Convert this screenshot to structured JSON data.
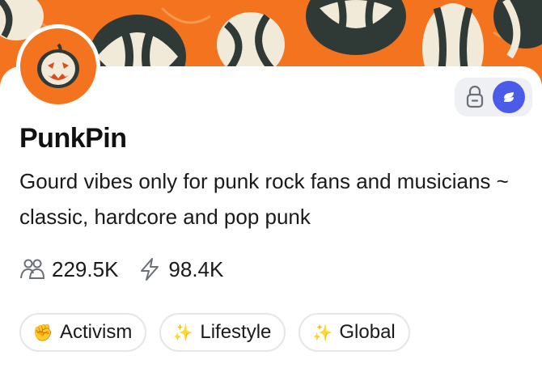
{
  "banner": {
    "background": "#f4731f",
    "pattern_icon": "gourd-pattern-icon"
  },
  "profile": {
    "avatar_icon": "pumpkin-avatar-icon",
    "name": "PunkPin",
    "description": "Gourd vibes only for punk rock fans and musicians ~ classic, hardcore and pop punk"
  },
  "badges": {
    "lock_icon": "lock-icon",
    "verified_icon": "verified-badge-icon",
    "accent": "#4a5be8"
  },
  "stats": {
    "members": {
      "icon": "members-icon",
      "value": "229.5K"
    },
    "activity": {
      "icon": "lightning-icon",
      "value": "98.4K"
    }
  },
  "tags": [
    {
      "emoji": "✊",
      "label": "Activism"
    },
    {
      "emoji": "✨",
      "label": "Lifestyle"
    },
    {
      "emoji": "✨",
      "label": "Global"
    }
  ]
}
